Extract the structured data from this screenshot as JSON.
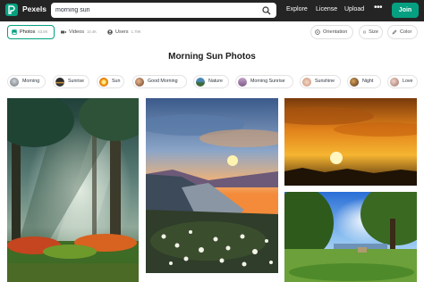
{
  "header": {
    "brand": "Pexels",
    "search_value": "morning sun",
    "nav": [
      "Explore",
      "License",
      "Upload"
    ],
    "more": "•••",
    "join_label": "Join"
  },
  "tabs": {
    "photos": {
      "label": "Photos",
      "count": "63.8K"
    },
    "videos": {
      "label": "Videos",
      "count": "10.4K"
    },
    "users": {
      "label": "Users",
      "count": "1.79K"
    }
  },
  "filters": {
    "orientation": "Orientation",
    "size": "Size",
    "color": "Color"
  },
  "page_title": "Morning Sun Photos",
  "chips": [
    "Morning",
    "Sunrise",
    "Sun",
    "Good Morning",
    "Nature",
    "Morning Sunrise",
    "Sunshine",
    "Night",
    "Love"
  ],
  "colors": {
    "brand_green": "#05a081",
    "header_bg": "#242424"
  }
}
